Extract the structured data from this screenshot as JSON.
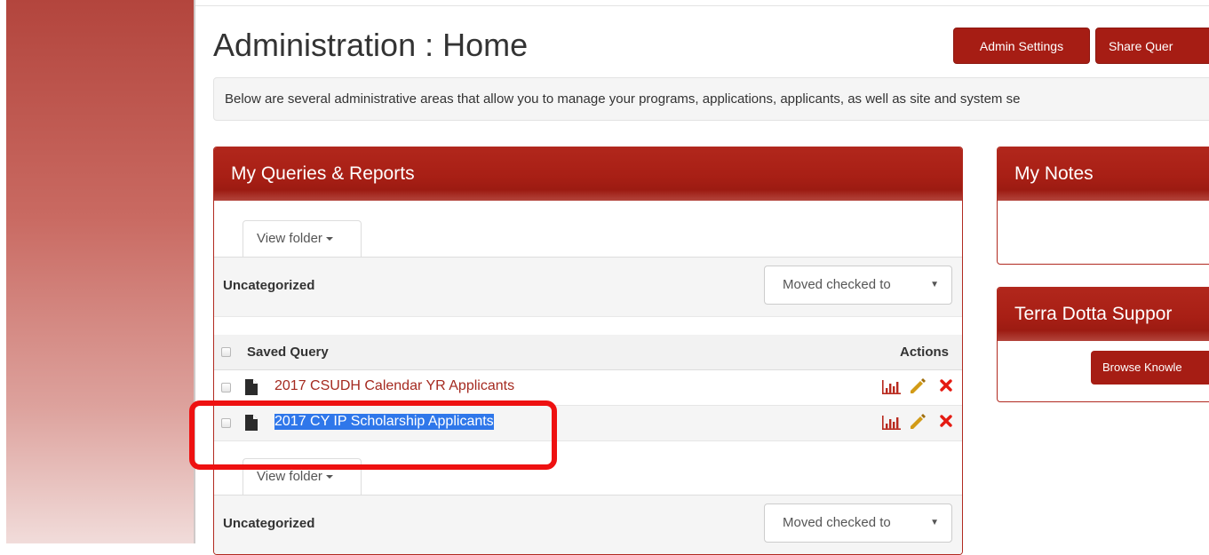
{
  "page": {
    "title": "Administration : Home",
    "intro": "Below are several administrative areas that allow you to manage your programs, applications, applicants, as well as site and system se"
  },
  "header_buttons": {
    "admin_settings": "Admin Settings",
    "share_queries": "Share Quer"
  },
  "queries_panel": {
    "title": "My Queries & Reports",
    "view_folder_label": "View folder",
    "folder_name": "Uncategorized",
    "move_select_value": "Moved checked to",
    "columns": {
      "saved_query": "Saved Query",
      "actions": "Actions"
    },
    "rows": [
      {
        "name": "2017 CSUDH Calendar YR Applicants",
        "selected": false
      },
      {
        "name": "2017 CY IP Scholarship Applicants",
        "selected": true
      }
    ],
    "second_folder": {
      "view_folder_label": "View folder",
      "folder_name": "Uncategorized",
      "move_select_value": "Moved checked to"
    }
  },
  "notes_panel": {
    "title": "My Notes"
  },
  "support_panel": {
    "title": "Terra Dotta Suppor",
    "browse_button": "Browse Knowle"
  },
  "icons": [
    "document-icon",
    "chart-icon",
    "pencil-icon",
    "delete-icon",
    "caret-down-icon"
  ],
  "colors": {
    "brand_red": "#a61d14",
    "link_red": "#a52a20",
    "selection_blue": "#2f77ea",
    "annotation_red": "#ee1111"
  }
}
